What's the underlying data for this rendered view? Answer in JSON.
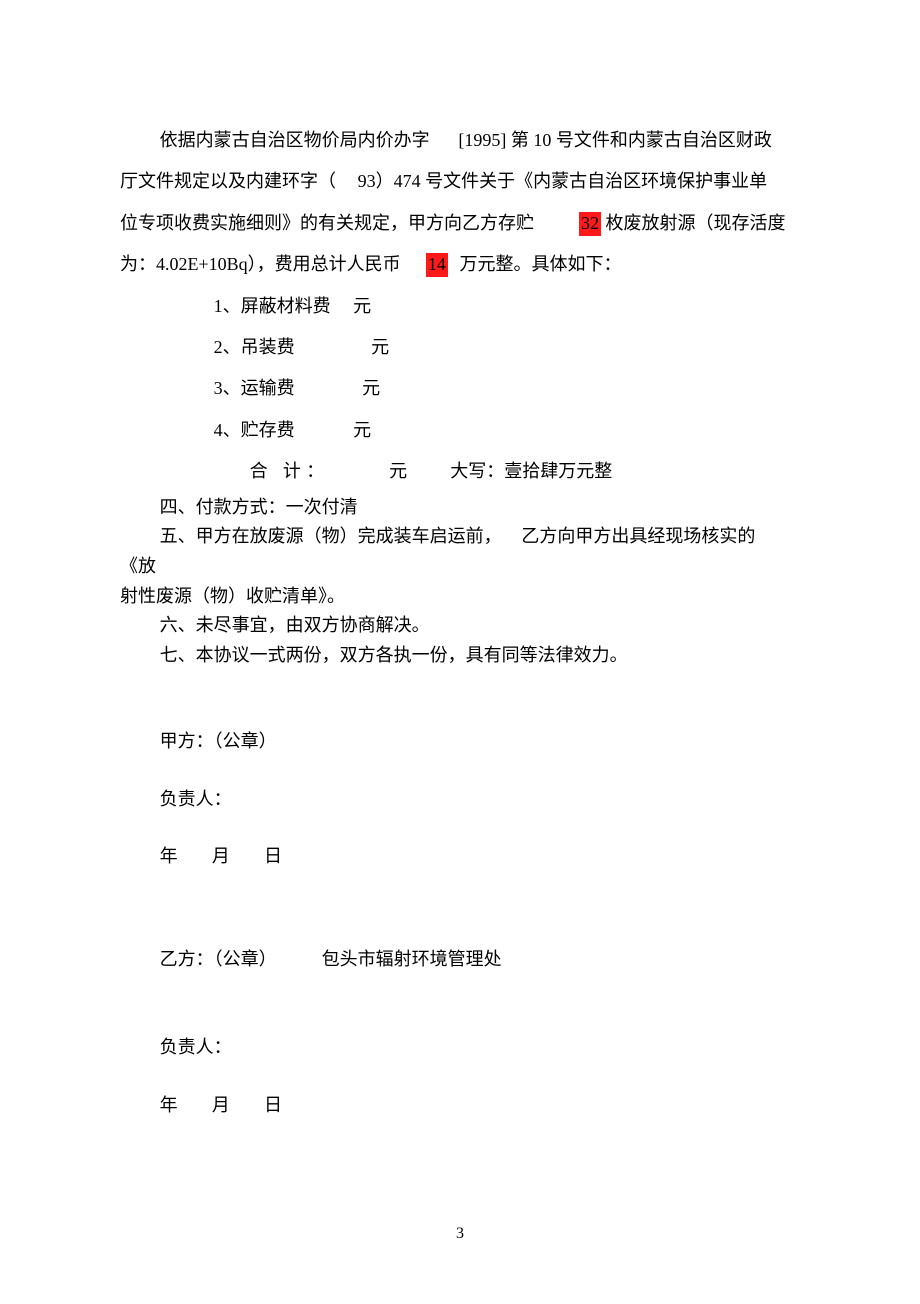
{
  "intro": {
    "pre1": "依据内蒙古自治区物价局内价办字",
    "docnum1": "[1995] 第 10 号文件和内蒙古自治区财政",
    "line2a": "厅文件规定以及内建环字（",
    "line2b": "93）474 号文件关于《内蒙古自治区环境保护事业单",
    "line3a": "位专项收费实施细则》的有关规定，甲方向乙方存贮",
    "hl1": "32",
    "line3b": "枚废放射源（现存活度",
    "line4a": "为：4.02E+10Bq），费用总计人民币",
    "hl2": "14",
    "line4b": "万元整。具体如下："
  },
  "fees": {
    "f1": {
      "label": "1、屏蔽材料费",
      "unit": "元"
    },
    "f2": {
      "label": "2、吊装费",
      "unit": "元"
    },
    "f3": {
      "label": "3、运输费",
      "unit": "元"
    },
    "f4": {
      "label": "4、贮存费",
      "unit": "元"
    },
    "total": {
      "label": "合  计：",
      "unit": "元",
      "daxie_label": "大写：",
      "daxie_value": "壹拾肆万元整"
    }
  },
  "clauses": {
    "c4": "四、付款方式：一次付清",
    "c5a": "五、甲方在放废源（物）完成装车启运前，",
    "c5b": "乙方向甲方出具经现场核实的",
    "c5c": "《放",
    "c5d": "射性废源（物）收贮清单》。",
    "c6": "六、未尽事宜，由双方协商解决。",
    "c7": "七、本协议一式两份，双方各执一份，具有同等法律效力。"
  },
  "sig": {
    "jiafang": "甲方：（公章）",
    "fuzeren": "负责人：",
    "yifang_label": "乙方：（公章）",
    "yifang_name": "包头市辐射环境管理处",
    "year": "年",
    "month": "月",
    "day": "日"
  },
  "pagenum": "3"
}
